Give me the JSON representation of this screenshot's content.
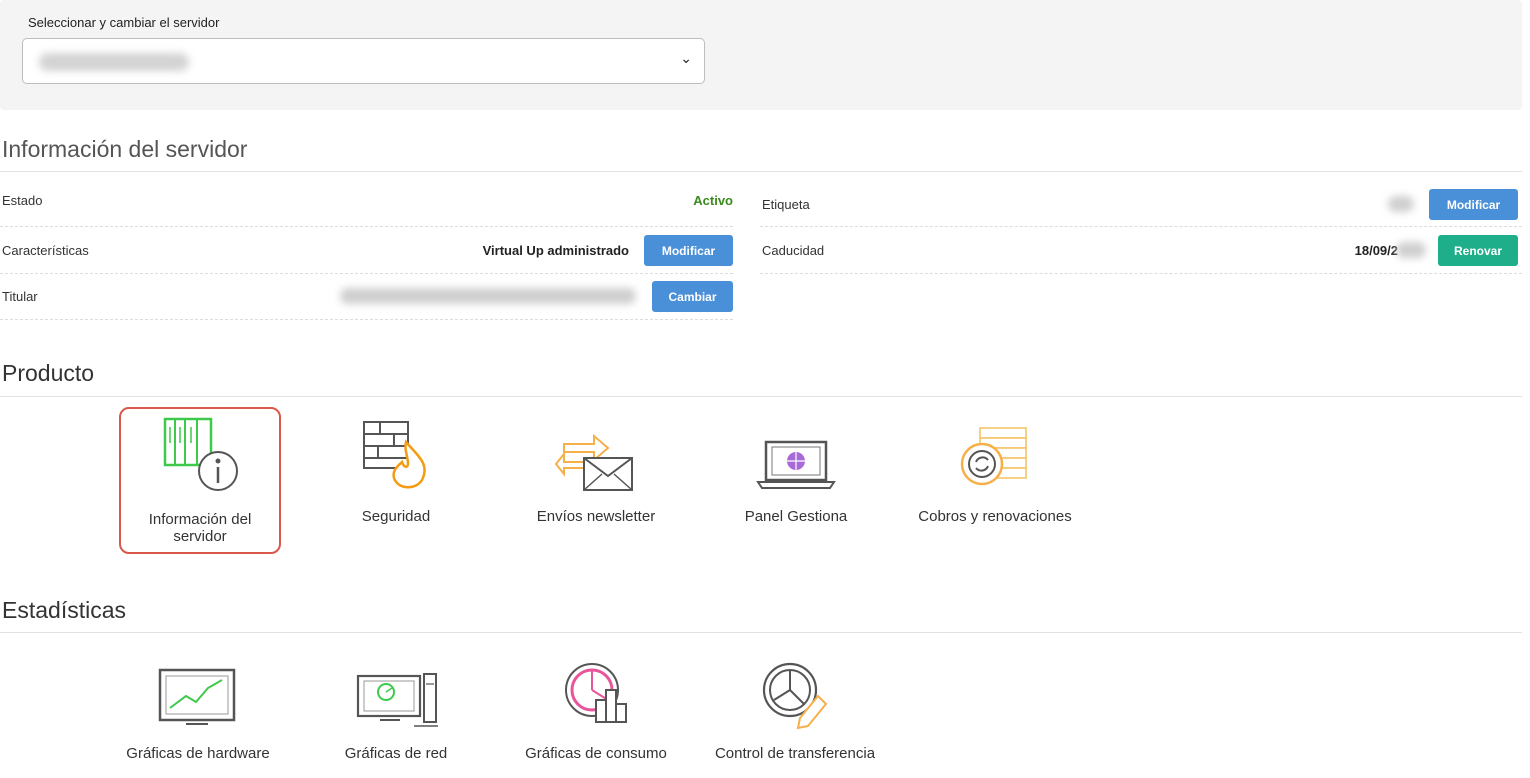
{
  "server_selector": {
    "label": "Seleccionar y cambiar el servidor",
    "chevron": "⌄"
  },
  "server_info": {
    "title": "Información del servidor",
    "estado": {
      "label": "Estado",
      "value": "Activo"
    },
    "caracteristicas": {
      "label": "Características",
      "value": "Virtual Up administrado",
      "button": "Modificar"
    },
    "titular": {
      "label": "Titular",
      "button": "Cambiar"
    },
    "etiqueta": {
      "label": "Etiqueta",
      "button": "Modificar"
    },
    "caducidad": {
      "label": "Caducidad",
      "value": "18/09/2",
      "button": "Renovar"
    }
  },
  "product": {
    "title": "Producto",
    "items": [
      {
        "label_line1": "Información del",
        "label_line2": "servidor",
        "icon": "server-info-icon"
      },
      {
        "label": "Seguridad",
        "icon": "firewall-icon"
      },
      {
        "label": "Envíos newsletter",
        "icon": "newsletter-icon"
      },
      {
        "label": "Panel Gestiona",
        "icon": "laptop-panel-icon"
      },
      {
        "label": "Cobros y renovaciones",
        "icon": "coins-icon"
      }
    ]
  },
  "stats": {
    "title": "Estadísticas",
    "items": [
      {
        "label": "Gráficas de hardware",
        "icon": "hardware-chart-icon"
      },
      {
        "label": "Gráficas de red",
        "icon": "network-chart-icon"
      },
      {
        "label": "Gráficas de consumo",
        "icon": "consumption-chart-icon"
      },
      {
        "label": "Control de transferencia",
        "icon": "transfer-control-icon"
      }
    ]
  },
  "colors": {
    "accent_blue": "#4a90d9",
    "accent_green": "#1fae8a",
    "status_active": "#3a8a1e",
    "selected_border": "#d9574b"
  }
}
